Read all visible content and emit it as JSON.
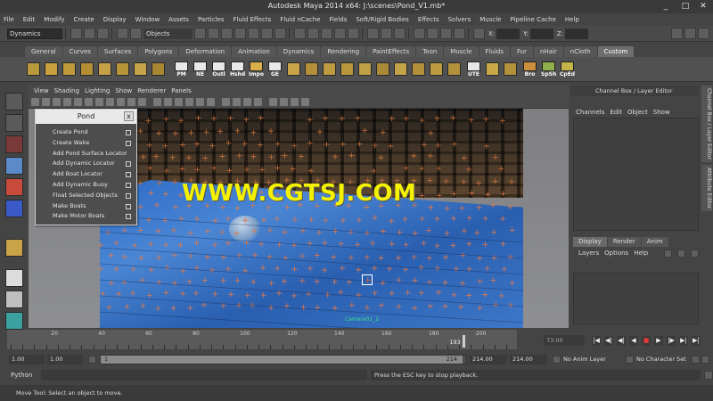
{
  "app": {
    "title": "Autodesk Maya 2014 x64: J:\\scenes\\Pond_V1.mb*",
    "window_controls": [
      "_",
      "□",
      "✕"
    ]
  },
  "menubar": [
    "File",
    "Edit",
    "Modify",
    "Create",
    "Display",
    "Window",
    "Assets",
    "Particles",
    "Fluid Effects",
    "Fluid nCache",
    "Fields",
    "Soft/Rigid Bodies",
    "Effects",
    "Solvers",
    "Muscle",
    "Pipeline Cache",
    "Help"
  ],
  "statusline": {
    "mode": "Dynamics",
    "objects_label": "Objects",
    "x_label": "X:",
    "y_label": "Y:",
    "z_label": "Z:"
  },
  "shelf_tabs": [
    "General",
    "Curves",
    "Surfaces",
    "Polygons",
    "Deformation",
    "Animation",
    "Dynamics",
    "Rendering",
    "PaintEffects",
    "Toon",
    "Muscle",
    "Fluids",
    "Fur",
    "nHair",
    "nCloth",
    "Custom"
  ],
  "shelf_active_tab": "Custom",
  "shelf_labels": [
    "PM",
    "NE",
    "Outl",
    "Hshd",
    "Impo",
    "GE",
    "UTE",
    "Bro",
    "SpSh",
    "CpEd"
  ],
  "viewport": {
    "menu": [
      "View",
      "Shading",
      "Lighting",
      "Show",
      "Renderer",
      "Panels"
    ],
    "camera_label": "Camera01_2",
    "watermark": "WWW.CGTSJ.COM"
  },
  "pond_window": {
    "title": "Pond",
    "close": "x",
    "items": [
      "Create Pond",
      "Create Wake",
      "Add Pond Surface Locator",
      "Add Dynamic Locator",
      "Add Boat Locator",
      "Add Dynamic Buoy",
      "Float Selected Objects",
      "Make Boats",
      "Make Motor Boats"
    ]
  },
  "right_panel": {
    "header": "Channel Box / Layer Editor",
    "channel_menu": [
      "Channels",
      "Edit",
      "Object",
      "Show"
    ],
    "layer_tabs": [
      "Display",
      "Render",
      "Anim"
    ],
    "layer_menu": [
      "Layers",
      "Options",
      "Help"
    ],
    "side_tabs": [
      "Channel Box / Layer Editor",
      "Attribute Editor"
    ]
  },
  "timeline": {
    "start": 1,
    "end": 214,
    "current_frame": 193,
    "labels": [
      20,
      40,
      60,
      80,
      100,
      120,
      140,
      160,
      180,
      200
    ],
    "frame_field": "73.00",
    "playback_buttons": [
      "|◀",
      "◀|",
      "◀|",
      "◀",
      "■",
      "▶",
      "|▶",
      "▶|",
      "▶|"
    ]
  },
  "range": {
    "start_field": "1.00",
    "inner_start_field": "1.00",
    "range_start_label": "1",
    "range_end_label": "214",
    "end_field": "214.00",
    "anim_end_field": "214.00",
    "anim_layer": "No Anim Layer",
    "character_set": "No Character Set"
  },
  "cmdline": {
    "language": "Python",
    "result": "Press the ESC key to stop playback."
  },
  "helpline": "Move Tool: Select an object to move."
}
